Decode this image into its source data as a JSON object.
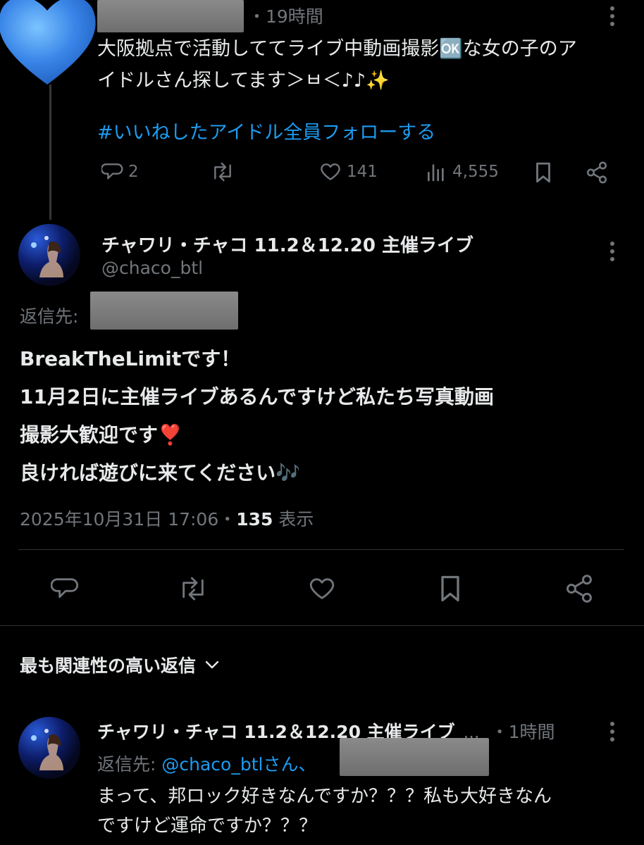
{
  "parent_tweet": {
    "time": "・19時間",
    "text_line1": "大阪拠点で活動しててライブ中動画撮影🆗な女の子のア",
    "text_line2": "イドルさん探してます＞ㅂ＜♪♪✨",
    "hashtag": "#いいねしたアイドル全員フォローする",
    "replies": "2",
    "likes": "141",
    "views": "4,555"
  },
  "main_tweet": {
    "display_name": "チャワリ・チャコ 11.2＆12.20 主催ライブ",
    "handle": "@chaco_btl",
    "reply_to_label": "返信先:",
    "lines": [
      "BreakTheLimitです！",
      "11月2日に主催ライブあるんですけど私たち写真動画",
      "撮影大歓迎です❣️",
      "良ければ遊びに来てください🎶"
    ],
    "timestamp": "2025年10月31日 17:06",
    "separator": "・",
    "views_count": "135",
    "views_label": "表示"
  },
  "replies_sort": {
    "label": "最も関連性の高い返信"
  },
  "reply_tweet": {
    "display_name": "チャワリ・チャコ 11.2＆12.20 主催ライブ",
    "ellipsis": "...",
    "time": "・1時間",
    "reply_to_label": "返信先:",
    "reply_to_handle": "@chaco_btlさん、",
    "line1": "まって、邦ロック好きなんですか？？？私も大好きなん",
    "line2": "ですけど運命ですか？？？"
  },
  "colors": {
    "background": "#000000",
    "text": "#e7e9ea",
    "muted": "#71767b",
    "accent": "#1d9bf0",
    "divider": "#2f3336"
  },
  "icons": {
    "heart_avatar": "blue-heart-icon",
    "reply": "reply-icon",
    "retweet": "retweet-icon",
    "like": "heart-icon",
    "views": "views-bar-icon",
    "bookmark": "bookmark-icon",
    "share": "share-icon",
    "more": "more-vertical-icon",
    "chevron": "chevron-down-icon"
  }
}
